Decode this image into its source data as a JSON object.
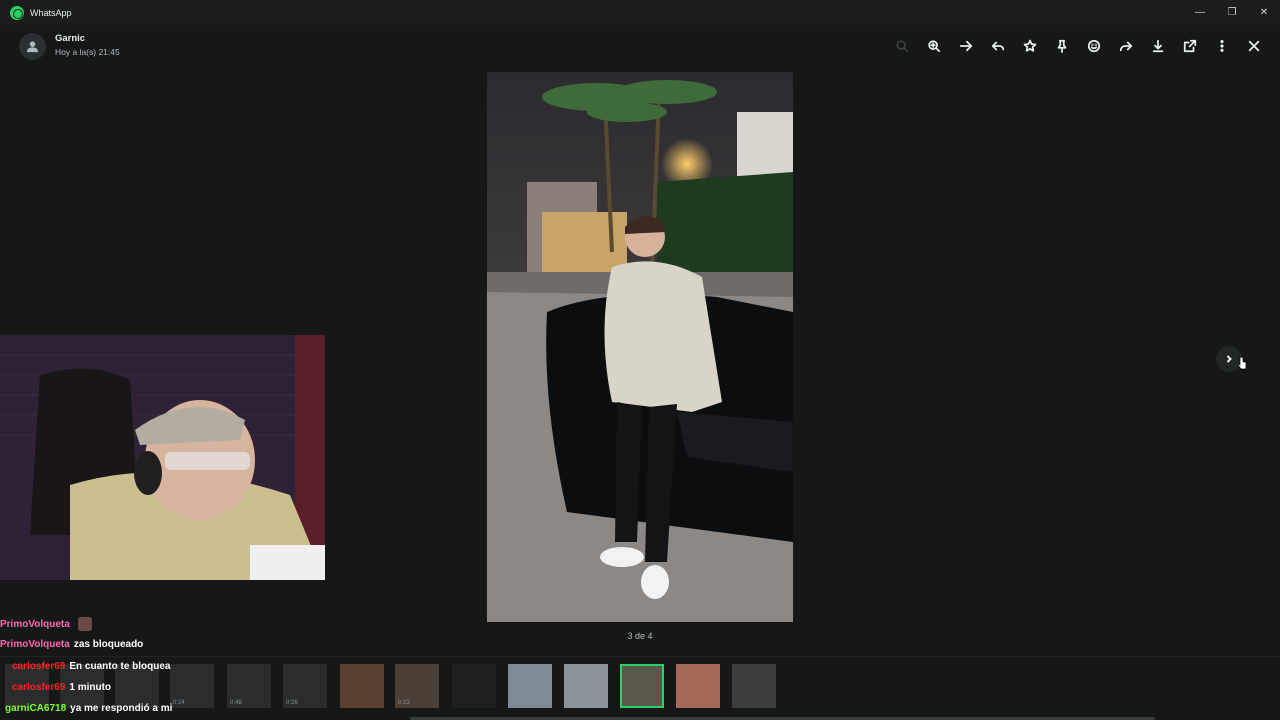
{
  "window": {
    "app_title": "WhatsApp",
    "controls": [
      "—",
      "❐",
      "✕"
    ]
  },
  "header": {
    "contact_name": "Garnic",
    "timestamp": "Hoy a la(s) 21:45"
  },
  "toolbar": {
    "icons": [
      "search-icon",
      "zoom-in-icon",
      "arrow-forward-icon",
      "reply-icon",
      "star-icon",
      "pin-icon",
      "emoji-icon",
      "forward-icon",
      "download-icon",
      "open-external-icon",
      "menu-icon",
      "close-icon"
    ]
  },
  "viewer": {
    "counter": "3 de 4"
  },
  "thumbnails": {
    "durations": [
      "0:24",
      "0:48",
      "0:26",
      "0:23"
    ],
    "selected_index": 11
  },
  "chat": {
    "lines": [
      {
        "user": "PrimoVolqueta",
        "msg": "",
        "color": "#ff69b4",
        "emote": true
      },
      {
        "user": "PrimoVolqueta",
        "msg": "zas bloqueado",
        "color": "#ff69b4",
        "emote": false
      },
      {
        "user": "carlosfer69",
        "msg": "En cuanto te bloquea",
        "color": "#ff2020",
        "emote": false
      },
      {
        "user": "carlosfer69",
        "msg": "1 minuto",
        "color": "#ff2020",
        "emote": false
      },
      {
        "user": "garniCA6718",
        "msg": "ya me respondió a mi",
        "color": "#7fff2a",
        "emote": false
      }
    ]
  },
  "colors": {
    "accent": "#25d366",
    "background": "#161717"
  }
}
